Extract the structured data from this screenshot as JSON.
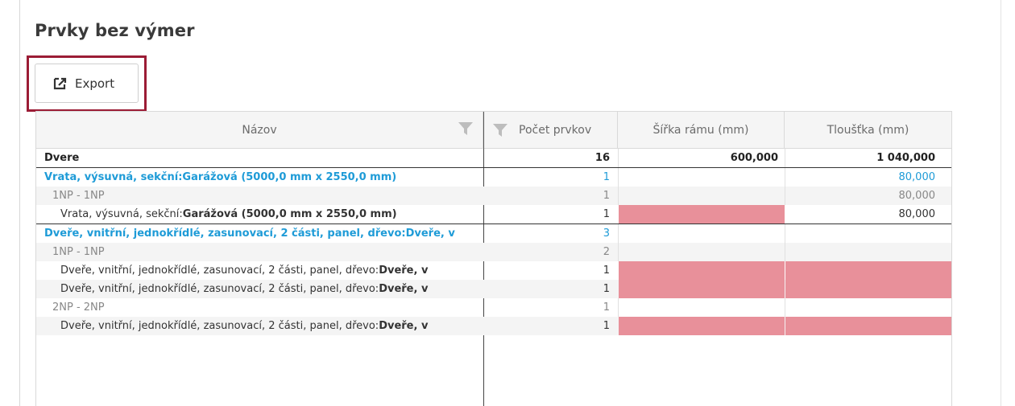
{
  "page": {
    "title": "Prvky bez výmer"
  },
  "toolbar": {
    "export_label": "Export"
  },
  "columns": {
    "name": "Názov",
    "count": "Počet prvkov",
    "frame_width": "Šířka rámu (mm)",
    "thickness": "Tloušťka (mm)"
  },
  "rows": [
    {
      "name": "Dvere",
      "count": "16",
      "frame_width": "600,000",
      "thickness": "1 040,000"
    },
    {
      "name": "Vrata, výsuvná, sekční:Garážová (5000,0 mm x 2550,0 mm)",
      "count": "1",
      "frame_width": "",
      "thickness": "80,000"
    },
    {
      "name": "1NP - 1NP",
      "count": "1",
      "frame_width": "",
      "thickness": "80,000"
    },
    {
      "name_prefix": "Vrata, výsuvná, sekční:",
      "name_bold": "Garážová (5000,0 mm x 2550,0 mm)",
      "count": "1",
      "frame_width": "",
      "thickness": "80,000"
    },
    {
      "name": "Dveře, vnitřní, jednokřídlé, zasunovací, 2 části, panel, dřevo:Dveře, v",
      "count": "3",
      "frame_width": "",
      "thickness": ""
    },
    {
      "name": "1NP - 1NP",
      "count": "2",
      "frame_width": "",
      "thickness": ""
    },
    {
      "name_prefix": "Dveře, vnitřní, jednokřídlé, zasunovací, 2 části, panel, dřevo:",
      "name_bold": "Dveře, v",
      "count": "1",
      "frame_width": "",
      "thickness": ""
    },
    {
      "name_prefix": "Dveře, vnitřní, jednokřídlé, zasunovací, 2 části, panel, dřevo:",
      "name_bold": "Dveře, v",
      "count": "1",
      "frame_width": "",
      "thickness": ""
    },
    {
      "name": "2NP - 2NP",
      "count": "1",
      "frame_width": "",
      "thickness": ""
    },
    {
      "name_prefix": "Dveře, vnitřní, jednokřídlé, zasunovací, 2 části, panel, dřevo:",
      "name_bold": "Dveře, v",
      "count": "1",
      "frame_width": "",
      "thickness": ""
    }
  ],
  "colors": {
    "accent": "#1e9bd7",
    "highlight_border": "#9b1c35",
    "missing_value": "#e8909a"
  }
}
